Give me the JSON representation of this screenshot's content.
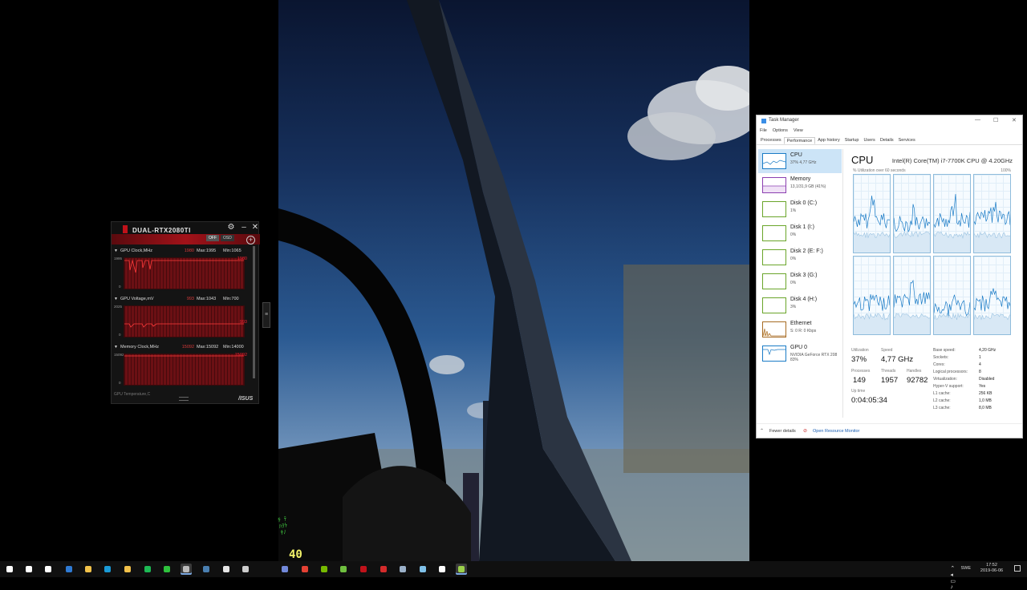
{
  "game": {
    "fps": "40"
  },
  "gpu_tweak": {
    "title": "DUAL-RTX2080TI",
    "osd_off": "OFF",
    "osd_label": "OSD",
    "monitors": [
      {
        "name": "GPU Clock,MHz",
        "current": "1980",
        "max": "Max:1995",
        "min": "Min:1065",
        "ytop": "1995",
        "ybottom": "0",
        "right_label": "1980"
      },
      {
        "name": "GPU Voltage,mV",
        "current": "993",
        "max": "Max:1043",
        "min": "Min:700",
        "ytop": "2025",
        "ybottom": "0",
        "right_label": "993"
      },
      {
        "name": "Memory Clock,MHz",
        "current": "15092",
        "max": "Max:15092",
        "min": "Min:14000",
        "ytop": "15092",
        "ybottom": "0",
        "right_label": "15092"
      }
    ],
    "cutoff_text": "GPU Temperature,C",
    "brand": "/ISUS"
  },
  "task_manager": {
    "window_title": "Task Manager",
    "menu": [
      "File",
      "Options",
      "View"
    ],
    "tabs": [
      "Processes",
      "Performance",
      "App history",
      "Startup",
      "Users",
      "Details",
      "Services"
    ],
    "active_tab": "Performance",
    "resources": [
      {
        "name": "CPU",
        "sub": "37% 4,77 GHz",
        "color": "#1a7bc6"
      },
      {
        "name": "Memory",
        "sub": "13,1/31,9 GB (41%)",
        "color": "#8b3fb0"
      },
      {
        "name": "Disk 0 (C:)",
        "sub": "1%",
        "color": "#6aa52a"
      },
      {
        "name": "Disk 1 (I:)",
        "sub": "0%",
        "color": "#6aa52a"
      },
      {
        "name": "Disk 2 (E: F:)",
        "sub": "0%",
        "color": "#6aa52a"
      },
      {
        "name": "Disk 3 (G:)",
        "sub": "0%",
        "color": "#6aa52a"
      },
      {
        "name": "Disk 4 (H:)",
        "sub": "3%",
        "color": "#6aa52a"
      },
      {
        "name": "Ethernet",
        "sub": "S: 0 R: 0 Kbps",
        "color": "#a76b22"
      },
      {
        "name": "GPU 0",
        "sub": "NVIDIA GeForce RTX 208",
        "sub2": "83%",
        "color": "#1a7bc6"
      }
    ],
    "cpu": {
      "heading": "CPU",
      "model": "Intel(R) Core(TM) i7-7700K CPU @ 4.20GHz",
      "util_label": "% Utilization over 60 seconds",
      "pct_label": "100%",
      "stats": {
        "utilization_label": "Utilization",
        "utilization": "37%",
        "speed_label": "Speed",
        "speed": "4,77 GHz",
        "processes_label": "Processes",
        "processes": "149",
        "threads_label": "Threads",
        "threads": "1957",
        "handles_label": "Handles",
        "handles": "92782",
        "uptime_label": "Up time",
        "uptime": "0:04:05:34"
      },
      "details": [
        [
          "Base speed:",
          "4,20 GHz"
        ],
        [
          "Sockets:",
          "1"
        ],
        [
          "Cores:",
          "4"
        ],
        [
          "Logical processors:",
          "8"
        ],
        [
          "Virtualization:",
          "Disabled"
        ],
        [
          "Hyper-V support:",
          "Yes"
        ],
        [
          "L1 cache:",
          "256 KB"
        ],
        [
          "L2 cache:",
          "1,0 MB"
        ],
        [
          "L3 cache:",
          "8,0 MB"
        ]
      ]
    },
    "footer": {
      "fewer_details": "Fewer details",
      "open_resource_monitor": "Open Resource Monitor"
    }
  },
  "taskbar": {
    "icons": [
      {
        "name": "start-icon",
        "color": "#ffffff"
      },
      {
        "name": "search-icon",
        "color": "#ffffff"
      },
      {
        "name": "task-view-icon",
        "color": "#ffffff"
      },
      {
        "name": "edge-icon",
        "color": "#2f7bd4"
      },
      {
        "name": "file-explorer-icon",
        "color": "#f1c24a"
      },
      {
        "name": "app-icon",
        "color": "#1a9ad6"
      },
      {
        "name": "store-icon",
        "color": "#f2c14a"
      },
      {
        "name": "spotify-icon",
        "color": "#1db954"
      },
      {
        "name": "razer-icon",
        "color": "#2ec23d"
      },
      {
        "name": "gpu-tweak-icon",
        "color": "#bbbbbb"
      },
      {
        "name": "steam-icon",
        "color": "#4a7fb0"
      },
      {
        "name": "mail-icon",
        "color": "#e6e6e6"
      },
      {
        "name": "terminal-icon",
        "color": "#cccccc"
      },
      {
        "name": "discord-icon",
        "color": "#7289da"
      },
      {
        "name": "chrome-icon",
        "color": "#e44134"
      },
      {
        "name": "nvidia-icon",
        "color": "#76b900"
      },
      {
        "name": "notepad-icon",
        "color": "#6fbf3f"
      },
      {
        "name": "rog-icon",
        "color": "#c0121a"
      },
      {
        "name": "asus-aura-icon",
        "color": "#d42b2b"
      },
      {
        "name": "sim-icon",
        "color": "#9ab0c8"
      },
      {
        "name": "file-icon",
        "color": "#7fc0e8"
      },
      {
        "name": "window-icon",
        "color": "#ffffff"
      },
      {
        "name": "task-manager-icon",
        "color": "#9bd04a"
      }
    ],
    "lang": "SWE",
    "time": "17:52",
    "date": "2019-06-06"
  }
}
